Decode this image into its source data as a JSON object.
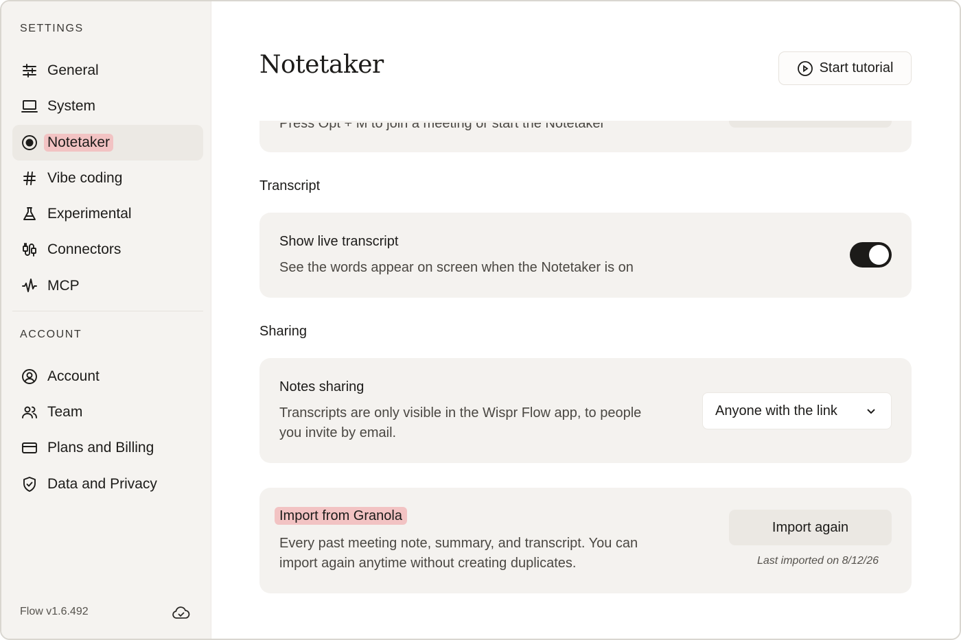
{
  "sidebar": {
    "settings_label": "SETTINGS",
    "account_label": "ACCOUNT",
    "settings_items": [
      {
        "label": "General",
        "icon": "sliders-icon"
      },
      {
        "label": "System",
        "icon": "laptop-icon"
      },
      {
        "label": "Notetaker",
        "icon": "record-icon"
      },
      {
        "label": "Vibe coding",
        "icon": "hash-icon"
      },
      {
        "label": "Experimental",
        "icon": "flask-icon"
      },
      {
        "label": "Connectors",
        "icon": "plug-icon"
      },
      {
        "label": "MCP",
        "icon": "waveform-icon"
      }
    ],
    "account_items": [
      {
        "label": "Account",
        "icon": "user-circle-icon"
      },
      {
        "label": "Team",
        "icon": "users-icon"
      },
      {
        "label": "Plans and Billing",
        "icon": "credit-card-icon"
      },
      {
        "label": "Data and Privacy",
        "icon": "shield-check-icon"
      }
    ],
    "active_item": "Notetaker",
    "version": "Flow v1.6.492"
  },
  "main": {
    "title": "Notetaker",
    "tutorial_button": "Start tutorial",
    "shortcut_card_text": "Press Opt + M to join a meeting or start the Notetaker",
    "transcript_group": "Transcript",
    "live_transcript": {
      "title": "Show live transcript",
      "description": "See the words appear on screen when the Notetaker is on",
      "enabled": true
    },
    "sharing_group": "Sharing",
    "notes_sharing": {
      "title": "Notes sharing",
      "description_line1": "Transcripts are only visible in the Wispr Flow app, to people",
      "description_line2": "you invite by email.",
      "selected": "Anyone with the link"
    },
    "granola": {
      "title": "Import from Granola",
      "description_line1": "Every past meeting note, summary, and transcript. You can",
      "description_line2": "import again anytime without creating duplicates.",
      "button": "Import again",
      "last_imported": "Last imported on 8/12/26"
    }
  },
  "colors": {
    "highlight": "#f2c3c3",
    "sidebar_bg": "#f5f3f0",
    "card_bg": "#f4f2ef",
    "toggle_on": "#1c1b19"
  }
}
